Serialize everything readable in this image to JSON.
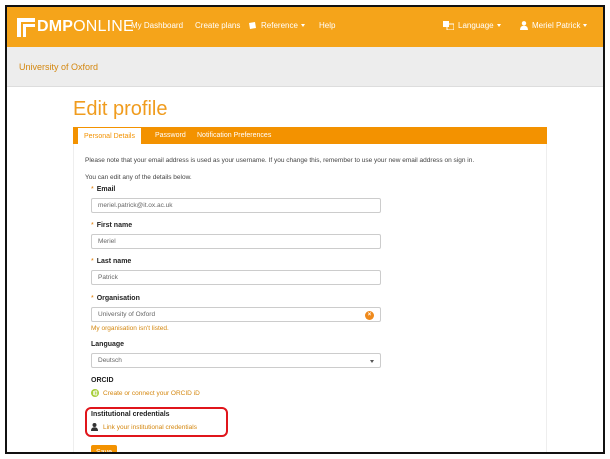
{
  "navbar": {
    "logo_bold": "DMP",
    "logo_light": "ONLINE",
    "items": [
      {
        "label": "My Dashboard"
      },
      {
        "label": "Create plans"
      },
      {
        "label": "Reference"
      },
      {
        "label": "Help"
      }
    ],
    "language_label": "Language",
    "user_label": "Meriel Patrick"
  },
  "breadcrumb": {
    "org": "University of Oxford"
  },
  "page": {
    "title": "Edit profile"
  },
  "tabs": [
    {
      "label": "Personal Details",
      "active": true
    },
    {
      "label": "Password",
      "active": false
    },
    {
      "label": "Notification Preferences",
      "active": false
    }
  ],
  "form": {
    "note": "Please note that your email address is used as your username. If you change this, remember to use your new email address on sign in.",
    "intro": "You can edit any of the details below.",
    "email": {
      "label": "Email",
      "value": "meriel.patrick@it.ox.ac.uk"
    },
    "first_name": {
      "label": "First name",
      "value": "Meriel"
    },
    "last_name": {
      "label": "Last name",
      "value": "Patrick"
    },
    "organisation": {
      "label": "Organisation",
      "value": "University of Oxford",
      "not_listed": "My organisation isn't listed."
    },
    "language": {
      "label": "Language",
      "value": "Deutsch"
    },
    "orcid": {
      "label": "ORCID",
      "link": "Create or connect your ORCID iD"
    },
    "institutional": {
      "label": "Institutional credentials",
      "link": "Link your institutional credentials"
    },
    "save_label": "Save"
  },
  "colors": {
    "accent": "#f39200",
    "link": "#d4870f",
    "highlight": "#e0151b"
  }
}
